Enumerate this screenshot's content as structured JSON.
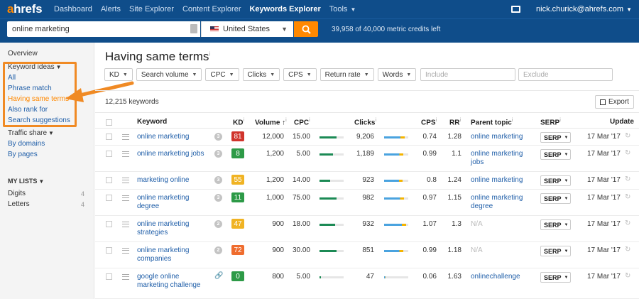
{
  "brand": {
    "logo_a": "a",
    "logo_rest": "hrefs",
    "accent": "#ff8800",
    "nav_bg": "#0f4d8a"
  },
  "nav": {
    "items": [
      "Dashboard",
      "Alerts",
      "Site Explorer",
      "Content Explorer",
      "Keywords Explorer",
      "Tools"
    ],
    "active": "Keywords Explorer",
    "user": "nick.churick@ahrefs.com"
  },
  "search": {
    "query": "online marketing",
    "country": "United States",
    "credits": "39,958 of 40,000 metric credits left"
  },
  "sidebar": {
    "overview": "Overview",
    "keyword_ideas": "Keyword ideas",
    "ideas": [
      "All",
      "Phrase match",
      "Having same terms",
      "Also rank for",
      "Search suggestions"
    ],
    "active_idea": "Having same terms",
    "traffic_share": "Traffic share",
    "traffic": [
      "By domains",
      "By pages"
    ],
    "my_lists": "MY LISTS",
    "lists": [
      {
        "name": "Digits",
        "count": "4"
      },
      {
        "name": "Letters",
        "count": "4"
      }
    ]
  },
  "main": {
    "title": "Having same terms",
    "filters": [
      "KD",
      "Search volume",
      "CPC",
      "Clicks",
      "CPS",
      "Return rate",
      "Words"
    ],
    "include_placeholder": "Include",
    "exclude_placeholder": "Exclude",
    "keyword_count": "12,215 keywords",
    "export": "Export",
    "columns": {
      "keyword": "Keyword",
      "kd": "KD",
      "volume": "Volume",
      "cpc": "CPC",
      "clicks": "Clicks",
      "cps": "CPS",
      "rr": "RR",
      "parent": "Parent topic",
      "serp": "SERP",
      "update": "Update"
    }
  },
  "rows": [
    {
      "keyword": "online marketing",
      "badge": "3",
      "kd": "81",
      "kd_color": "#d0342c",
      "volume": "12,000",
      "cpc": "15.00",
      "cpc_fill": 0.7,
      "clicks": "9,206",
      "clicks_fill": 0.85,
      "cps": "0.74",
      "rr": "1.28",
      "parent": "online marketing",
      "serp": "SERP",
      "update": "17 Mar '17"
    },
    {
      "keyword": "online marketing jobs",
      "badge": "3",
      "kd": "8",
      "kd_color": "#2d9a47",
      "volume": "1,200",
      "cpc": "5.00",
      "cpc_fill": 0.55,
      "clicks": "1,189",
      "clicks_fill": 0.8,
      "cps": "0.99",
      "rr": "1.1",
      "parent": "online marketing jobs",
      "serp": "SERP",
      "update": "17 Mar '17"
    },
    {
      "keyword": "marketing online",
      "badge": "3",
      "kd": "55",
      "kd_color": "#f0b323",
      "volume": "1,200",
      "cpc": "14.00",
      "cpc_fill": 0.45,
      "clicks": "923",
      "clicks_fill": 0.75,
      "cps": "0.8",
      "rr": "1.24",
      "parent": "online marketing",
      "serp": "SERP",
      "update": "17 Mar '17"
    },
    {
      "keyword": "online marketing degree",
      "badge": "3",
      "kd": "11",
      "kd_color": "#2d9a47",
      "volume": "1,000",
      "cpc": "75.00",
      "cpc_fill": 0.72,
      "clicks": "982",
      "clicks_fill": 0.82,
      "cps": "0.97",
      "rr": "1.15",
      "parent": "online marketing degree",
      "serp": "SERP",
      "update": "17 Mar '17"
    },
    {
      "keyword": "online marketing strategies",
      "badge": "2",
      "kd": "47",
      "kd_color": "#f0b323",
      "volume": "900",
      "cpc": "18.00",
      "cpc_fill": 0.65,
      "clicks": "932",
      "clicks_fill": 0.9,
      "cps": "1.07",
      "rr": "1.3",
      "parent": "N/A",
      "serp": "SERP",
      "update": "17 Mar '17"
    },
    {
      "keyword": "online marketing companies",
      "badge": "2",
      "kd": "72",
      "kd_color": "#ef6c2e",
      "volume": "900",
      "cpc": "30.00",
      "cpc_fill": 0.7,
      "clicks": "851",
      "clicks_fill": 0.8,
      "cps": "0.99",
      "rr": "1.18",
      "parent": "N/A",
      "serp": "SERP",
      "update": "17 Mar '17"
    },
    {
      "keyword": "google online marketing challenge",
      "badge": "",
      "kd": "0",
      "kd_color": "#2d9a47",
      "volume": "800",
      "cpc": "5.00",
      "cpc_fill": 0.05,
      "clicks": "47",
      "clicks_fill": 0.05,
      "cps": "0.06",
      "rr": "1.63",
      "parent": "onlinechallenge",
      "serp": "SERP",
      "update": "17 Mar '17"
    }
  ]
}
